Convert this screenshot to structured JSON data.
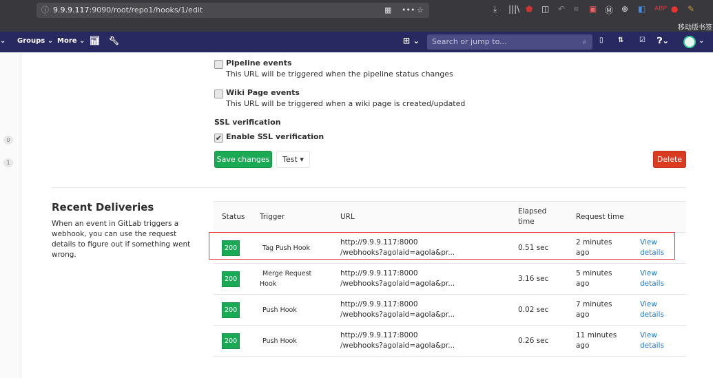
{
  "browser": {
    "url_host": "9.9.9.117",
    "url_rest": ":9090/root/repo1/hooks/1/edit",
    "bookmark": "移动版书签"
  },
  "nav": {
    "groups": "Groups",
    "more": "More",
    "search_placeholder": "Search or jump to..."
  },
  "sidebar": {
    "badges": [
      "0",
      "1"
    ]
  },
  "events": [
    {
      "label": "Pipeline events",
      "help": "This URL will be triggered when the pipeline status changes",
      "checked": false
    },
    {
      "label": "Wiki Page events",
      "help": "This URL will be triggered when a wiki page is created/updated",
      "checked": false
    }
  ],
  "ssl": {
    "heading": "SSL verification",
    "label": "Enable SSL verification",
    "checked": true
  },
  "buttons": {
    "save": "Save changes",
    "test": "Test",
    "delete": "Delete"
  },
  "deliveries": {
    "title": "Recent Deliveries",
    "description": "When an event in GitLab triggers a webhook, you can use the request details to figure out if something went wrong.",
    "headers": [
      "Status",
      "Trigger",
      "URL",
      "Elapsed time",
      "Request time",
      ""
    ],
    "rows": [
      {
        "status": "200",
        "trigger": "Tag Push Hook",
        "url1": "http://9.9.9.117:8000",
        "url2": "/webhooks?agolaid=agola&pr...",
        "elapsed": "0.51 sec",
        "time": "2 minutes ago",
        "link": "View details"
      },
      {
        "status": "200",
        "trigger": "Merge Request Hook",
        "url1": "http://9.9.9.117:8000",
        "url2": "/webhooks?agolaid=agola&pr...",
        "elapsed": "3.16 sec",
        "time": "5 minutes ago",
        "link": "View details"
      },
      {
        "status": "200",
        "trigger": "Push Hook",
        "url1": "http://9.9.9.117:8000",
        "url2": "/webhooks?agolaid=agola&pr...",
        "elapsed": "0.02 sec",
        "time": "7 minutes ago",
        "link": "View details"
      },
      {
        "status": "200",
        "trigger": "Push Hook",
        "url1": "http://9.9.9.117:8000",
        "url2": "/webhooks?agolaid=agola&pr...",
        "elapsed": "0.26 sec",
        "time": "11 minutes ago",
        "link": "View details"
      }
    ]
  },
  "colors": {
    "nav": "#292961",
    "success": "#1aaa55",
    "danger": "#db3b21",
    "highlight": "#e5303a"
  }
}
